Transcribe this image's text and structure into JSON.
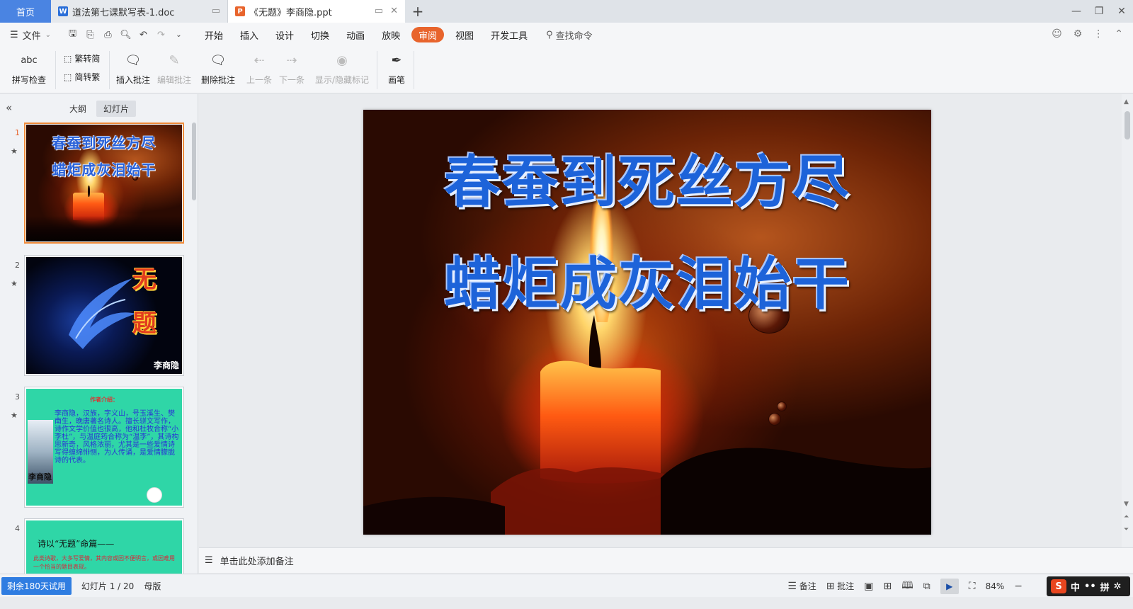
{
  "tabs": {
    "home": "首页",
    "doc": "道法第七课默写表-1.doc",
    "ppt": "《无题》李商隐.ppt"
  },
  "menu": {
    "file": "文件",
    "tabs": [
      "开始",
      "插入",
      "设计",
      "切换",
      "动画",
      "放映",
      "审阅",
      "视图",
      "开发工具"
    ],
    "active_tab": "审阅",
    "search": "查找命令"
  },
  "ribbon": {
    "spellcheck": "拼写检查",
    "trad": "繁转简",
    "simp": "简转繁",
    "insert_comment": "插入批注",
    "edit_comment": "编辑批注",
    "delete_comment": "删除批注",
    "prev": "上一条",
    "next": "下一条",
    "show_hide": "显示/隐藏标记",
    "pen": "画笔",
    "abc": "abc"
  },
  "panel": {
    "outline": "大纲",
    "slides": "幻灯片",
    "numbers": [
      "1",
      "2",
      "3",
      "4"
    ]
  },
  "slide1": {
    "line1": "春蚕到死丝方尽",
    "line2": "蜡炬成灰泪始干"
  },
  "slide2": {
    "char1": "无",
    "char2": "题",
    "author": "李商隐"
  },
  "slide3": {
    "title": "作者介绍：",
    "body": "李商隐，汉族，字义山，号玉溪生、樊南生，晚唐著名诗人。擅长骈文写作，诗作文学价值也很高，他和杜牧合称“小李杜”，与温庭筠合称为“温李”，其诗构思新奇，风格浓丽，尤其是一些爱情诗写得缠绵悱恻，为人传诵，是爱情朦胧诗的代表。",
    "author": "李商隐"
  },
  "slide4": {
    "title": "诗以“无题”命篇——",
    "body": "此类诗歌，大多写爱情，其内容或因不便明言，或因难用一个恰当的题目表现。"
  },
  "notes": {
    "placeholder": "单击此处添加备注"
  },
  "status": {
    "trial": "剩余180天试用",
    "slide_counter": "幻灯片 1 / 20",
    "master": "母版",
    "notes": "备注",
    "comments": "批注",
    "zoom": "84%",
    "ime_mode": "中",
    "ime_pinyin": "拼"
  },
  "colors": {
    "accent": "#e8642c",
    "home_tab": "#4a84e2",
    "trial_badge": "#2f7de1",
    "title_blue": "#1d63d9"
  }
}
